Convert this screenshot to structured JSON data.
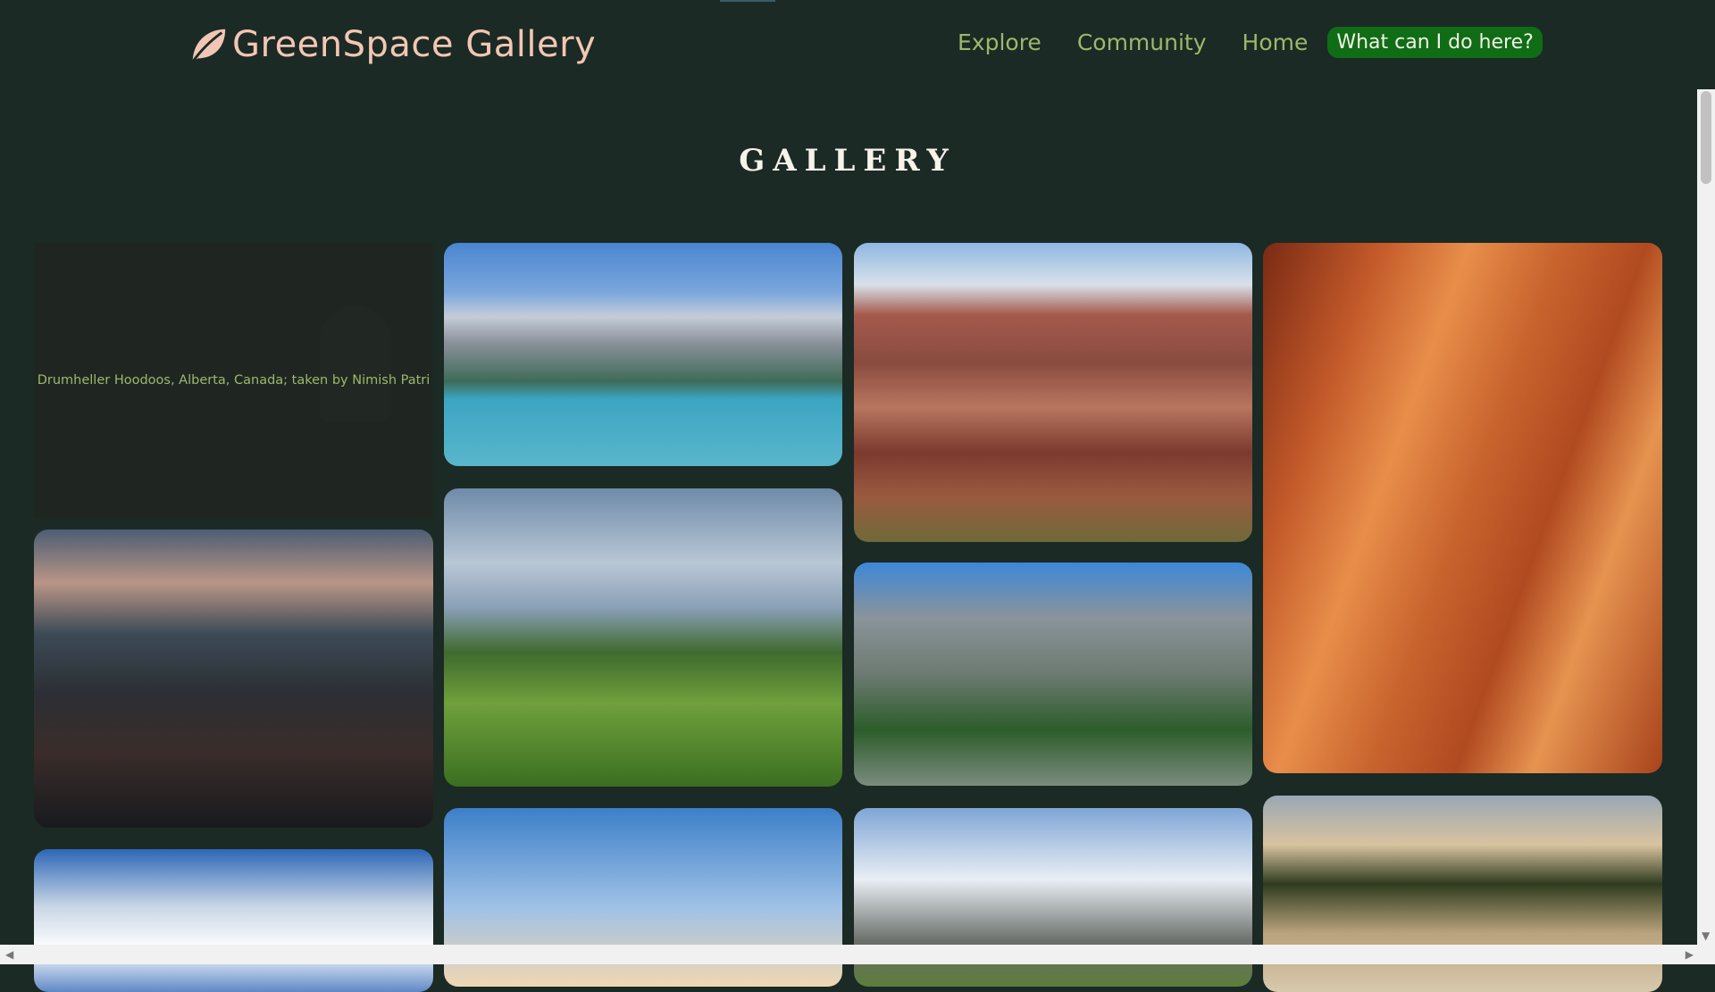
{
  "brand": {
    "name": "GreenSpace Gallery",
    "color": "#f2c6b4"
  },
  "nav": {
    "links": [
      "Explore",
      "Community",
      "Home"
    ],
    "help_button": "What can I do here?"
  },
  "page": {
    "title": "GALLERY"
  },
  "gallery": {
    "caption": "Drumheller Hoodoos, Alberta, Canada; taken by Nimish Patri"
  },
  "colors": {
    "background": "#1b2a24",
    "accent_green": "#9db86a",
    "help_bg": "#0f6d16"
  }
}
